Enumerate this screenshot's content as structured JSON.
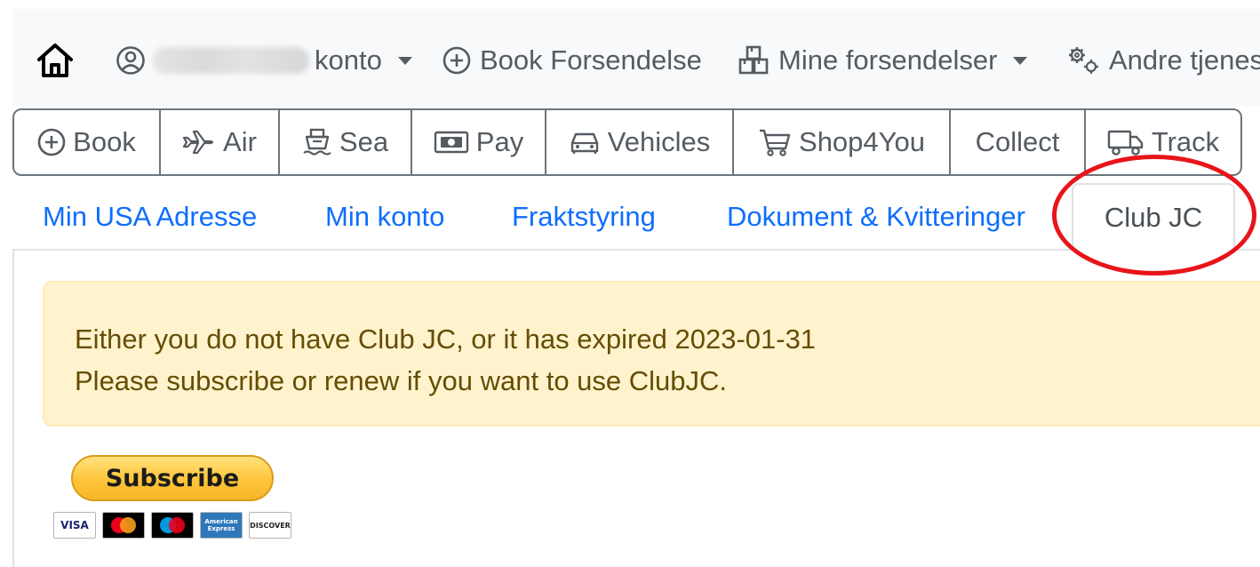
{
  "topnav": {
    "account_suffix": "konto",
    "book_shipment": "Book Forsendelse",
    "my_shipments": "Mine forsendelser",
    "other_services": "Andre tjenes"
  },
  "services": [
    {
      "label": "Book",
      "icon": "plus-circle-icon"
    },
    {
      "label": "Air",
      "icon": "airplane-icon"
    },
    {
      "label": "Sea",
      "icon": "ship-icon"
    },
    {
      "label": "Pay",
      "icon": "cash-icon"
    },
    {
      "label": "Vehicles",
      "icon": "car-icon"
    },
    {
      "label": "Shop4You",
      "icon": "cart-icon"
    },
    {
      "label": "Collect",
      "icon": ""
    },
    {
      "label": "Track",
      "icon": "truck-icon"
    }
  ],
  "tabs": [
    {
      "label": "Min USA Adresse"
    },
    {
      "label": "Min konto"
    },
    {
      "label": "Fraktstyring"
    },
    {
      "label": "Dokument & Kvitteringer"
    },
    {
      "label": "Club JC",
      "active": true
    }
  ],
  "alert": {
    "line1": "Either you do not have Club JC, or it has expired 2023-01-31",
    "line2": "Please subscribe or renew if you want to use ClubJC."
  },
  "subscribe_label": "Subscribe",
  "payment_cards": [
    "VISA",
    "Mastercard",
    "Maestro",
    "American Express",
    "DISCOVER"
  ],
  "colors": {
    "link": "#0d6efd",
    "alert_bg": "#fff3cd",
    "alert_text": "#664d03",
    "highlight": "#e8141a",
    "paypal_yellow": "#ffc439"
  }
}
